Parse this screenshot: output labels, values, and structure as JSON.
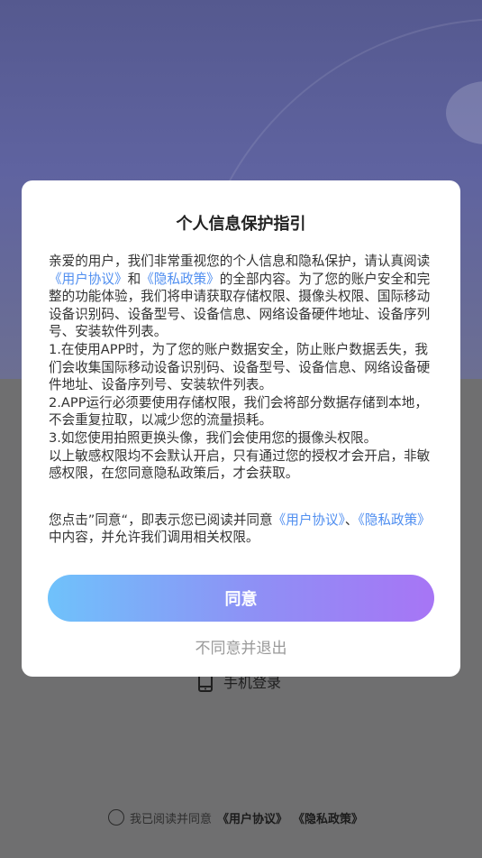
{
  "background": {
    "phone_login_label": "手机登录",
    "agreement": {
      "prefix": "我已阅读并同意",
      "user_agreement": "《用户协议》",
      "privacy_policy": "《隐私政策》"
    }
  },
  "modal": {
    "title": "个人信息保护指引",
    "intro_before": "亲爱的用户，我们非常重视您的个人信息和隐私保护，请认真阅读",
    "link_user_agreement": "《用户协议》",
    "and": "和",
    "link_privacy_policy": "《隐私政策》",
    "intro_after": "的全部内容。为了您的账户安全和完整的功能体验，我们将申请获取存储权限、摄像头权限、国际移动设备识别码、设备型号、设备信息、网络设备硬件地址、设备序列号、安装软件列表。",
    "item1": "1.在使用APP时，为了您的账户数据安全，防止账户数据丢失，我们会收集国际移动设备识别码、设备型号、设备信息、网络设备硬件地址、设备序列号、安装软件列表。",
    "item2": "2.APP运行必须要使用存储权限，我们会将部分数据存储到本地，不会重复拉取，以减少您的流量损耗。",
    "item3": "3.如您使用拍照更换头像，我们会使用您的摄像头权限。",
    "note": "以上敏感权限均不会默认开启，只有通过您的授权才会开启，非敏感权限，在您同意隐私政策后，才会获取。",
    "consent_before": "您点击”同意“，即表示您已阅读并同意",
    "consent_link_user": "《用户协议》",
    "consent_sep": "、",
    "consent_link_privacy": "《隐私政策》",
    "consent_after": "中内容，并允许我们调用相关权限。",
    "agree_label": "同意",
    "disagree_label": "不同意并退出"
  },
  "colors": {
    "link": "#4f8ef0",
    "button_gradient_start": "#6fc2fb",
    "button_gradient_end": "#a775f5"
  },
  "icons": [
    "phone-icon",
    "radio-unchecked-icon"
  ]
}
